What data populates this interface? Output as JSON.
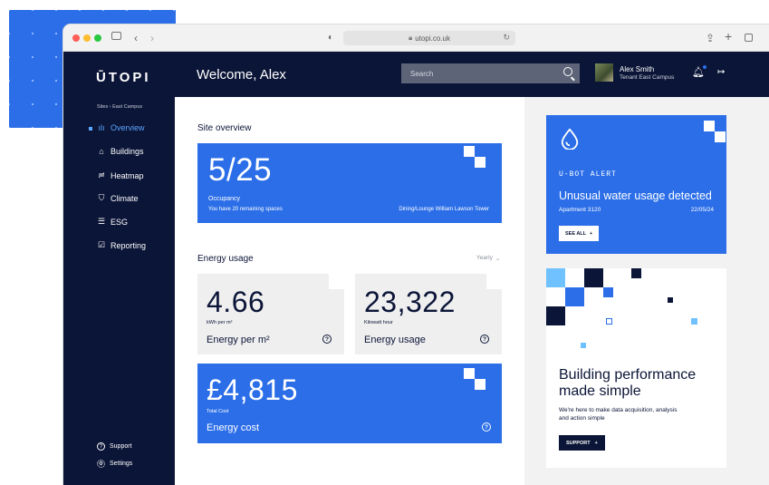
{
  "browser": {
    "url": "utopi.co.uk",
    "icons": [
      "sidebar-toggle-icon",
      "back-icon",
      "forward-icon",
      "shield-icon",
      "lock-icon",
      "reload-icon",
      "share-icon",
      "new-tab-icon",
      "tabs-icon"
    ]
  },
  "header": {
    "logo": "ŪTOPI",
    "welcome": "Welcome, Alex",
    "search_placeholder": "Search",
    "user_name": "Alex Smith",
    "user_role": "Tenant East Campus"
  },
  "sidebar": {
    "breadcrumb": "Sites › East Campus",
    "items": [
      {
        "label": "Overview",
        "icon": "bar-chart-icon",
        "active": true
      },
      {
        "label": "Buildings",
        "icon": "home-icon",
        "active": false
      },
      {
        "label": "Heatmap",
        "icon": "heatmap-icon",
        "active": false
      },
      {
        "label": "Climate",
        "icon": "shield-icon",
        "active": false
      },
      {
        "label": "ESG",
        "icon": "server-icon",
        "active": false
      },
      {
        "label": "Reporting",
        "icon": "checkbox-icon",
        "active": false
      }
    ],
    "footer": [
      {
        "label": "Support",
        "icon": "help-icon"
      },
      {
        "label": "Settings",
        "icon": "gear-icon"
      }
    ]
  },
  "site_overview": {
    "title": "Site overview",
    "value": "5/25",
    "label": "Occupancy",
    "sublabel": "You have 20 remaining spaces",
    "location": "Dining/Lounge William Lawson Tower"
  },
  "energy": {
    "title": "Energy usage",
    "period": "Yearly",
    "per_m2": {
      "value": "4.66",
      "unit": "kWh per m²",
      "label": "Energy per m²"
    },
    "usage": {
      "value": "23,322",
      "unit": "Kilowatt hour",
      "label": "Energy usage"
    },
    "cost": {
      "value": "£4,815",
      "unit": "Total Cost",
      "label": "Energy cost"
    }
  },
  "alert": {
    "kicker": "U-BOT ALERT",
    "title": "Unusual water usage detected",
    "location": "Apartment 3120",
    "date": "22/05/24",
    "button": "SEE ALL"
  },
  "promo": {
    "title": "Building performance made simple",
    "text": "We're here to make data acquisition, analysis and action simple",
    "button": "SUPPORT"
  },
  "colors": {
    "navy": "#0b1537",
    "blue": "#2b6ee8",
    "light_blue": "#5ba6ff",
    "grey": "#efefef"
  }
}
